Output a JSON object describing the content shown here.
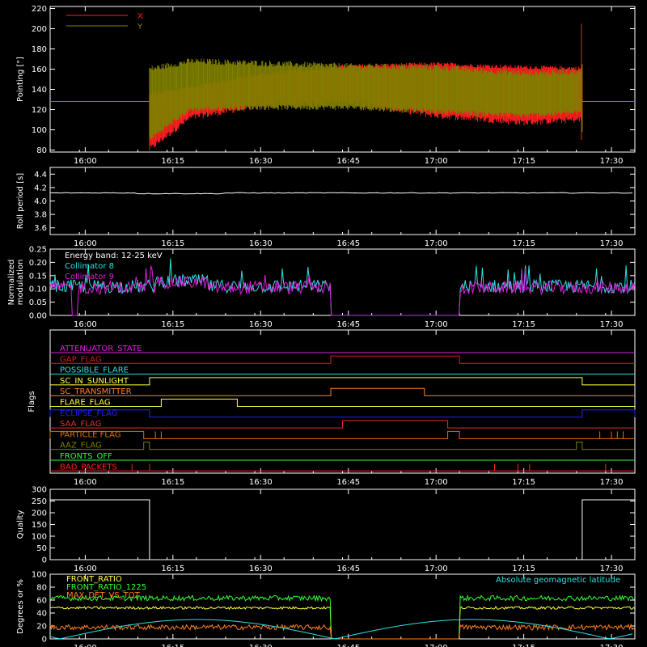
{
  "colors": {
    "background": "#000000",
    "axes": "#ffffff",
    "red": "#ff2020",
    "olive": "#808000",
    "cyan": "#30e0e0",
    "magenta": "#e020e0",
    "white": "#ffffff",
    "yellow": "#ffff40",
    "green": "#30ff30",
    "orange": "#ff8020",
    "blue": "#2020ff",
    "darkorange": "#e07000",
    "darkred": "#d02020",
    "bandred": "#e03030"
  },
  "time_axis": {
    "range": [
      "15:54",
      "17:34"
    ],
    "tick_labels": [
      "16:00",
      "16:15",
      "16:30",
      "16:45",
      "17:00",
      "17:15",
      "17:30"
    ]
  },
  "chart_data": [
    {
      "type": "line",
      "ylabel": "Pointing [\"]",
      "ylim": [
        78,
        222
      ],
      "yticks": [
        "80",
        "100",
        "120",
        "140",
        "160",
        "180",
        "200",
        "220"
      ],
      "legend": [
        "X",
        "Y"
      ],
      "legend_placement": "top-left",
      "series": [
        {
          "name": "X",
          "color": "red",
          "x_range": [
            "16:11",
            "17:25"
          ],
          "envelope_upper": [
            [
              16.18,
              135
            ],
            [
              16.5,
              155
            ],
            [
              16.75,
              163
            ],
            [
              17.0,
              165
            ],
            [
              17.25,
              162
            ],
            [
              17.41,
              161
            ]
          ],
          "envelope_lower": [
            [
              16.18,
              80
            ],
            [
              16.3,
              112
            ],
            [
              16.5,
              124
            ],
            [
              16.75,
              127
            ],
            [
              17.0,
              114
            ],
            [
              17.25,
              107
            ],
            [
              17.41,
              110
            ]
          ]
        },
        {
          "name": "Y",
          "color": "olive",
          "x_range": [
            "15:54",
            "17:34"
          ],
          "flat_value": 128,
          "envelope_upper": [
            [
              16.18,
              160
            ],
            [
              16.3,
              168
            ],
            [
              16.5,
              166
            ],
            [
              16.75,
              163
            ],
            [
              17.0,
              162
            ],
            [
              17.25,
              156
            ],
            [
              17.41,
              158
            ]
          ],
          "envelope_lower": [
            [
              16.18,
              90
            ],
            [
              16.3,
              120
            ],
            [
              16.5,
              122
            ],
            [
              16.75,
              122
            ],
            [
              17.0,
              118
            ],
            [
              17.25,
              114
            ],
            [
              17.41,
              117
            ]
          ]
        }
      ]
    },
    {
      "type": "line",
      "ylabel": "Roll period [s]",
      "ylim": [
        3.5,
        4.5
      ],
      "yticks": [
        "3.6",
        "3.8",
        "4.0",
        "4.2",
        "4.4"
      ],
      "series": [
        {
          "name": "",
          "color": "white",
          "values_approx": 4.12,
          "x_range": [
            "15:54",
            "17:34"
          ]
        }
      ]
    },
    {
      "type": "line",
      "ylabel": "Normalized modulation",
      "ylim": [
        0.0,
        0.25
      ],
      "yticks": [
        "0.00",
        "0.05",
        "0.10",
        "0.15",
        "0.20",
        "0.25"
      ],
      "legend": [
        "Energy band: 12-25 keV",
        "Collimator 8",
        "Collimator 9"
      ],
      "series": [
        {
          "name": "Collimator 8",
          "color": "cyan",
          "mean": 0.11,
          "data_intervals": [
            [
              "15:54",
              "16:42"
            ],
            [
              "17:04",
              "17:34"
            ]
          ]
        },
        {
          "name": "Collimator 9",
          "color": "magenta",
          "mean": 0.105,
          "data_intervals": [
            [
              "15:54",
              "16:42"
            ],
            [
              "17:04",
              "17:34"
            ]
          ]
        }
      ]
    },
    {
      "type": "line",
      "ylabel": "Flags",
      "flags": [
        {
          "name": "ATTENUATOR_STATE",
          "color": "magenta",
          "high_intervals": []
        },
        {
          "name": "GAP_FLAG",
          "color": "darkred",
          "high_intervals": [
            [
              "16:42",
              "17:04"
            ]
          ]
        },
        {
          "name": "POSSIBLE_FLARE",
          "color": "cyan",
          "high_intervals": []
        },
        {
          "name": "SC_IN_SUNLIGHT",
          "color": "yellow",
          "high_intervals": [
            [
              "16:11",
              "17:25"
            ]
          ]
        },
        {
          "name": "SC_TRANSMITTER",
          "color": "orange",
          "high_intervals": [
            [
              "16:42",
              "16:58"
            ]
          ]
        },
        {
          "name": "FLARE_FLAG",
          "color": "yellow",
          "high_intervals": [
            [
              "16:13",
              "16:26"
            ]
          ]
        },
        {
          "name": "ECLIPSE_FLAG",
          "color": "blue",
          "high_intervals": [
            [
              "15:54",
              "16:11"
            ],
            [
              "17:25",
              "17:34"
            ]
          ]
        },
        {
          "name": "SAA_FLAG",
          "color": "bandred",
          "high_intervals": [
            [
              "16:44",
              "17:02"
            ]
          ]
        },
        {
          "name": "PARTICLE FLAG",
          "color": "darkorange",
          "high_intervals": [
            [
              "15:54",
              "16:10"
            ],
            [
              "17:02",
              "17:04"
            ]
          ]
        },
        {
          "name": "AAZ_FLAG",
          "color": "olive",
          "high_intervals": [
            [
              "16:10",
              "16:11"
            ],
            [
              "17:24",
              "17:25"
            ]
          ]
        },
        {
          "name": "FRONTS_OFF",
          "color": "green",
          "high_intervals": []
        },
        {
          "name": "BAD_PACKETS",
          "color": "red",
          "high_intervals": []
        }
      ]
    },
    {
      "type": "line",
      "ylabel": "Quality",
      "ylim": [
        0,
        300
      ],
      "yticks": [
        "0",
        "50",
        "100",
        "150",
        "200",
        "250",
        "300"
      ],
      "series": [
        {
          "name": "",
          "color": "white",
          "segments": [
            [
              "15:54",
              "16:11",
              255
            ],
            [
              "16:11",
              "17:25",
              0
            ],
            [
              "17:25",
              "17:34",
              255
            ]
          ]
        }
      ]
    },
    {
      "type": "line",
      "ylabel": "Degrees or %",
      "ylim": [
        0,
        100
      ],
      "yticks": [
        "0",
        "20",
        "40",
        "60",
        "80",
        "100"
      ],
      "legend": [
        "FRONT_RATIO",
        "FRONT_RATIO_1225",
        "MAX_DET_VS_TOT",
        "Absolute geomagnetic latitude"
      ],
      "series": [
        {
          "name": "FRONT_RATIO",
          "color": "yellow",
          "mean": 48
        },
        {
          "name": "FRONT_RATIO_1225",
          "color": "green",
          "mean": 63
        },
        {
          "name": "MAX_DET_VS_TOT",
          "color": "orange",
          "mean": 18
        },
        {
          "name": "Absolute geomagnetic latitude",
          "color": "cyan",
          "min": 0,
          "max": 30
        }
      ]
    }
  ]
}
